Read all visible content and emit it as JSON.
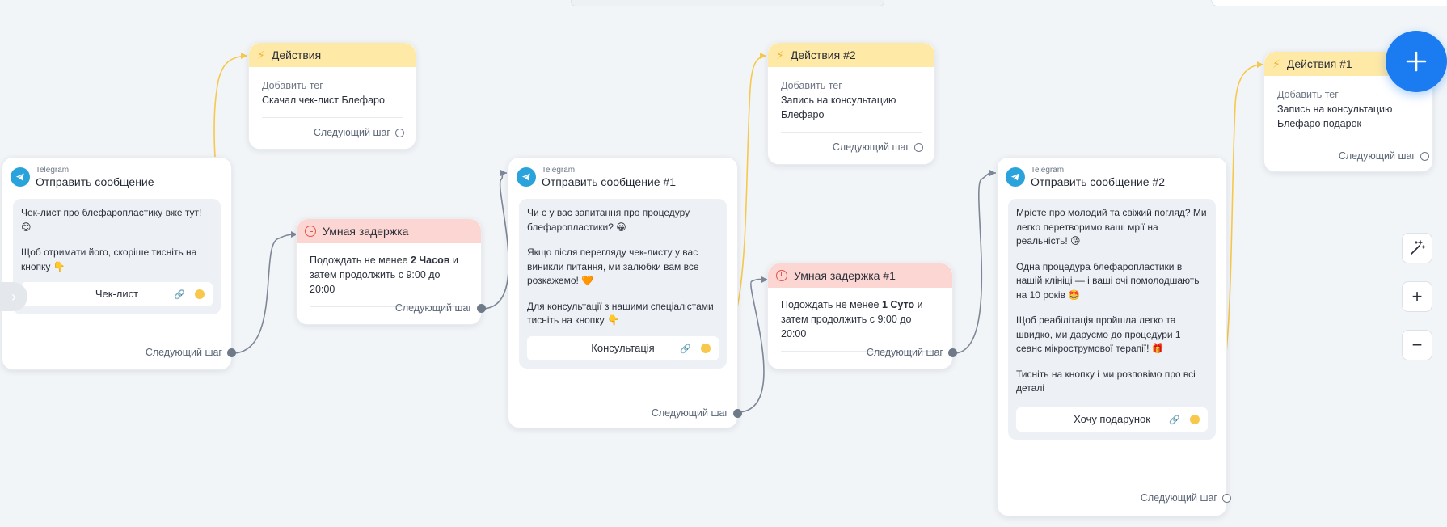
{
  "common": {
    "next_step": "Следующий шаг",
    "telegram": "Telegram",
    "add_tag": "Добавить тег"
  },
  "actions_1": {
    "title": "Действия",
    "tag": "Скачал чек-лист Блефаро"
  },
  "actions_2": {
    "title": "Действия #2",
    "tag_line1": "Запись на консультацию",
    "tag_line2": "Блефаро"
  },
  "actions_3": {
    "title": "Действия #1",
    "tag_line1": "Запись на консультацию",
    "tag_line2": "Блефаро подарок"
  },
  "delay_1": {
    "title": "Умная задержка",
    "pre": "Подождать не менее ",
    "amount": "2 Часов",
    "post": " и",
    "line2": "затем продолжить с 9:00 до 20:00"
  },
  "delay_2": {
    "title": "Умная задержка #1",
    "pre": "Подождать не менее ",
    "amount": "1 Суто",
    "post": " и",
    "line2": "затем продолжить с 9:00 до 20:00"
  },
  "message_1": {
    "title": "Отправить сообщение",
    "p1": "Чек-лист про блефаропластику вже тут! 😊",
    "p2": "Щоб отримати його, скоріше тисніть на кнопку 👇",
    "button": "Чек-лист"
  },
  "message_2": {
    "title": "Отправить сообщение #1",
    "p1": "Чи є у вас запитання про процедуру блефаропластики? 😀",
    "p2": "Якщо після перегляду чек-листу у вас виникли питання, ми залюбки вам все розкажемо! 🧡",
    "p3": "Для консультації з нашими спеціалістами тисніть на кнопку 👇",
    "button": "Консультація"
  },
  "message_3": {
    "title": "Отправить сообщение #2",
    "p1": "Мрієте про молодий та свіжий погляд? Ми легко перетворимо ваші мрії на реальність! 😘",
    "p2": "Одна процедура блефаропластики в нашій клініці — і ваші очі помолодшають на 10 років 🤩",
    "p3": "Щоб реабілітація пройшла легко та швидко, ми даруємо до процедури 1 сеанс мікрострумової терапії! 🎁",
    "p4": "Тисніть на кнопку і ми розповімо про всі деталі",
    "button": "Хочу подарунок"
  },
  "colors": {
    "accent": "#1a7cf0",
    "action_header": "#ffe9a6",
    "delay_header": "#fcd6d2",
    "telegram": "#2aa3dd",
    "wire_grey": "#7d8797",
    "wire_yellow": "#f7c84b"
  },
  "controls": {
    "add": "+",
    "zoom_in": "+",
    "zoom_out": "−",
    "magic_icon": "magic-wand-icon"
  }
}
